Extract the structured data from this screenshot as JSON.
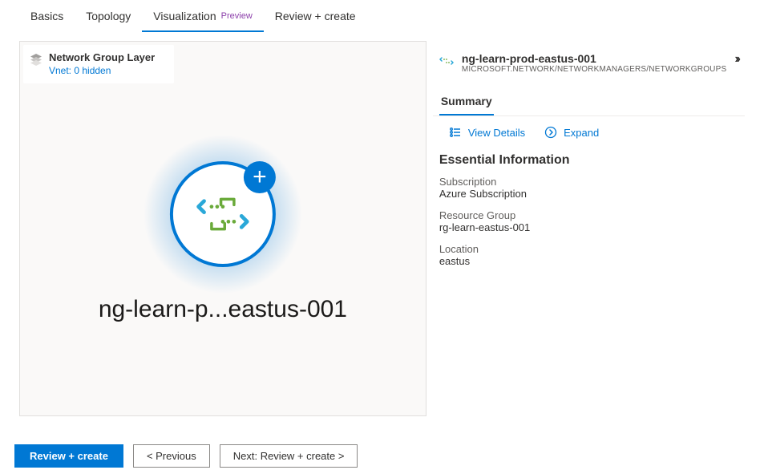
{
  "tabs": {
    "basics": "Basics",
    "topology": "Topology",
    "visualization": "Visualization",
    "preview_badge": "Preview",
    "review_create": "Review + create"
  },
  "layer": {
    "title": "Network Group Layer",
    "subtitle": "Vnet: 0 hidden"
  },
  "node": {
    "label": "ng-learn-p...eastus-001",
    "plus": "+"
  },
  "side": {
    "title": "ng-learn-prod-eastus-001",
    "subtitle": "MICROSOFT.NETWORK/NETWORKMANAGERS/NETWORKGROUPS",
    "summary_tab": "Summary",
    "view_details": "View Details",
    "expand": "Expand",
    "essential_heading": "Essential Information",
    "info": {
      "subscription_label": "Subscription",
      "subscription_value": "Azure Subscription",
      "rg_label": "Resource Group",
      "rg_value": "rg-learn-eastus-001",
      "location_label": "Location",
      "location_value": "eastus"
    }
  },
  "footer": {
    "review_create": "Review + create",
    "previous": "<  Previous",
    "next": "Next: Review + create  >"
  }
}
